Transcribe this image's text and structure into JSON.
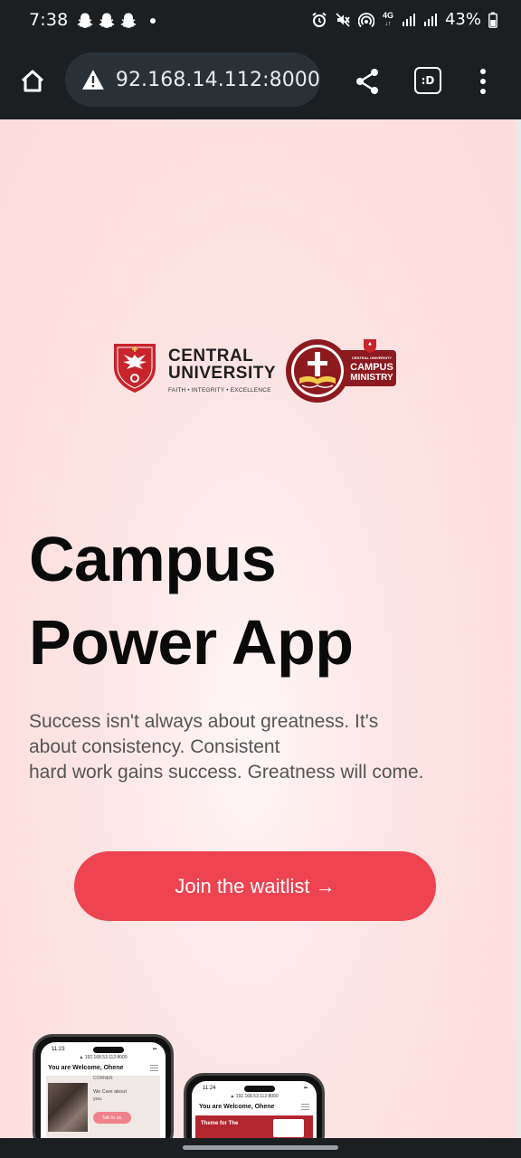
{
  "status_bar": {
    "time": "7:38",
    "network": "4G",
    "battery": "43%"
  },
  "browser": {
    "url": "92.168.14.112:8000",
    "tabs_label": ":D"
  },
  "logos": {
    "university_line1": "CENTRAL",
    "university_line2": "UNIVERSITY",
    "university_tagline": "FAITH • INTEGRITY • EXCELLENCE",
    "ministry_small": "CENTRAL UNIVERSITY",
    "ministry_line1": "CAMPUS",
    "ministry_line2": "MINISTRY"
  },
  "hero": {
    "title_line1": "Campus",
    "title_line2": "Power App",
    "text_line1": "Success isn't always about greatness. It's",
    "text_line2": "about consistency. Consistent",
    "text_line3": "hard work gains success. Greatness will come.",
    "cta_label": "Join the waitlist →"
  },
  "phone_left": {
    "time": "11:23",
    "url": "▲ 192.168.53.112:8000",
    "welcome": "You are Welcome, Ohene",
    "card_label": "CORNER",
    "card_text": "We Care about you.",
    "card_button": "Talk to us."
  },
  "phone_right": {
    "time": "11:24",
    "url": "▲ 192.168.53.112:8000",
    "welcome": "You are Welcome, Ohene",
    "banner_text": "Theme for The"
  },
  "colors": {
    "accent": "#ee4350",
    "crest_red": "#c8242c",
    "ministry_red": "#8d1a1f",
    "chrome": "#1b1f22"
  }
}
